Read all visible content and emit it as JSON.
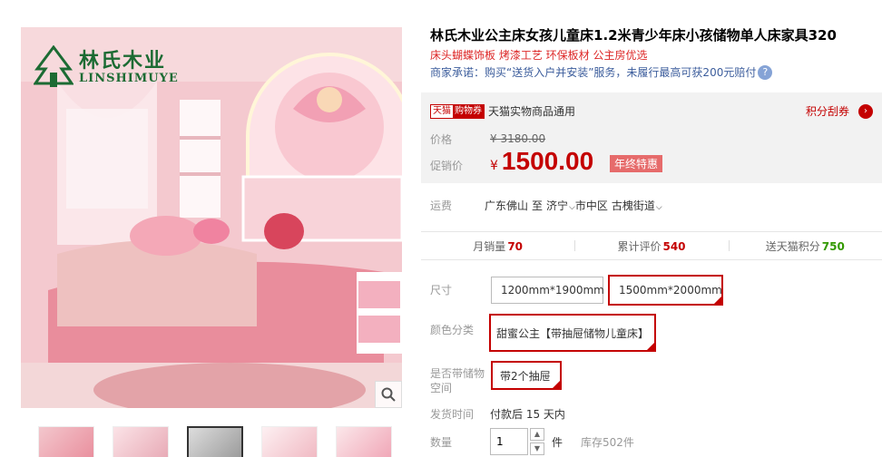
{
  "brand": {
    "name_cn": "林氏木业",
    "name_en": "LINSHIMUYE",
    "logo_small": "林氏木业",
    "color": "#1c6b33"
  },
  "gallery": {
    "zoom_icon": "magnifier-icon",
    "thumbnails": [
      {
        "label": "thumb-1",
        "active": false
      },
      {
        "label": "thumb-2",
        "active": false
      },
      {
        "label": "thumb-3",
        "active": true
      },
      {
        "label": "thumb-4",
        "active": false
      },
      {
        "label": "thumb-5",
        "active": false
      }
    ]
  },
  "product": {
    "title": "林氏木业公主床女孩儿童床1.2米青少年床小孩储物单人床家具320",
    "subtitle": "床头蝴蝶饰板 烤漆工艺 环保板材 公主房优选",
    "promise": "商家承诺：购买“送货入户并安装”服务，未履行最高可获200元赔付"
  },
  "price_box": {
    "tag_a": "天猫",
    "tag_b": "购物券",
    "coupon_text": "天猫实物商品通用",
    "points_link": "积分刮券",
    "price_label": "价格",
    "old_price": "¥ 3180.00",
    "promo_label": "促销价",
    "currency": "¥",
    "promo_price": "1500.00",
    "promo_badge": "年终特惠",
    "accent": "#c40000"
  },
  "shipping": {
    "label": "运费",
    "from": "广东佛山",
    "to_word": "至",
    "city": "济宁",
    "district": "市中区",
    "street": "古槐街道"
  },
  "stats": [
    {
      "label": "月销量",
      "value": "70",
      "green": false
    },
    {
      "label": "累计评价",
      "value": "540",
      "green": false
    },
    {
      "label": "送天猫积分",
      "value": "750",
      "green": true
    }
  ],
  "options": {
    "size_label": "尺寸",
    "size_values": [
      "1200mm*1900mm",
      "1500mm*2000mm"
    ],
    "color_label": "颜色分类",
    "color_value": "甜蜜公主【带抽屉储物儿童床】",
    "storage_label_1": "是否带储物",
    "storage_label_2": "空间",
    "storage_value": "带2个抽屉"
  },
  "delivery": {
    "label": "发货时间",
    "value": "付款后 15 天内"
  },
  "quantity": {
    "label": "数量",
    "value": "1",
    "unit": "件",
    "stock": "库存502件"
  }
}
